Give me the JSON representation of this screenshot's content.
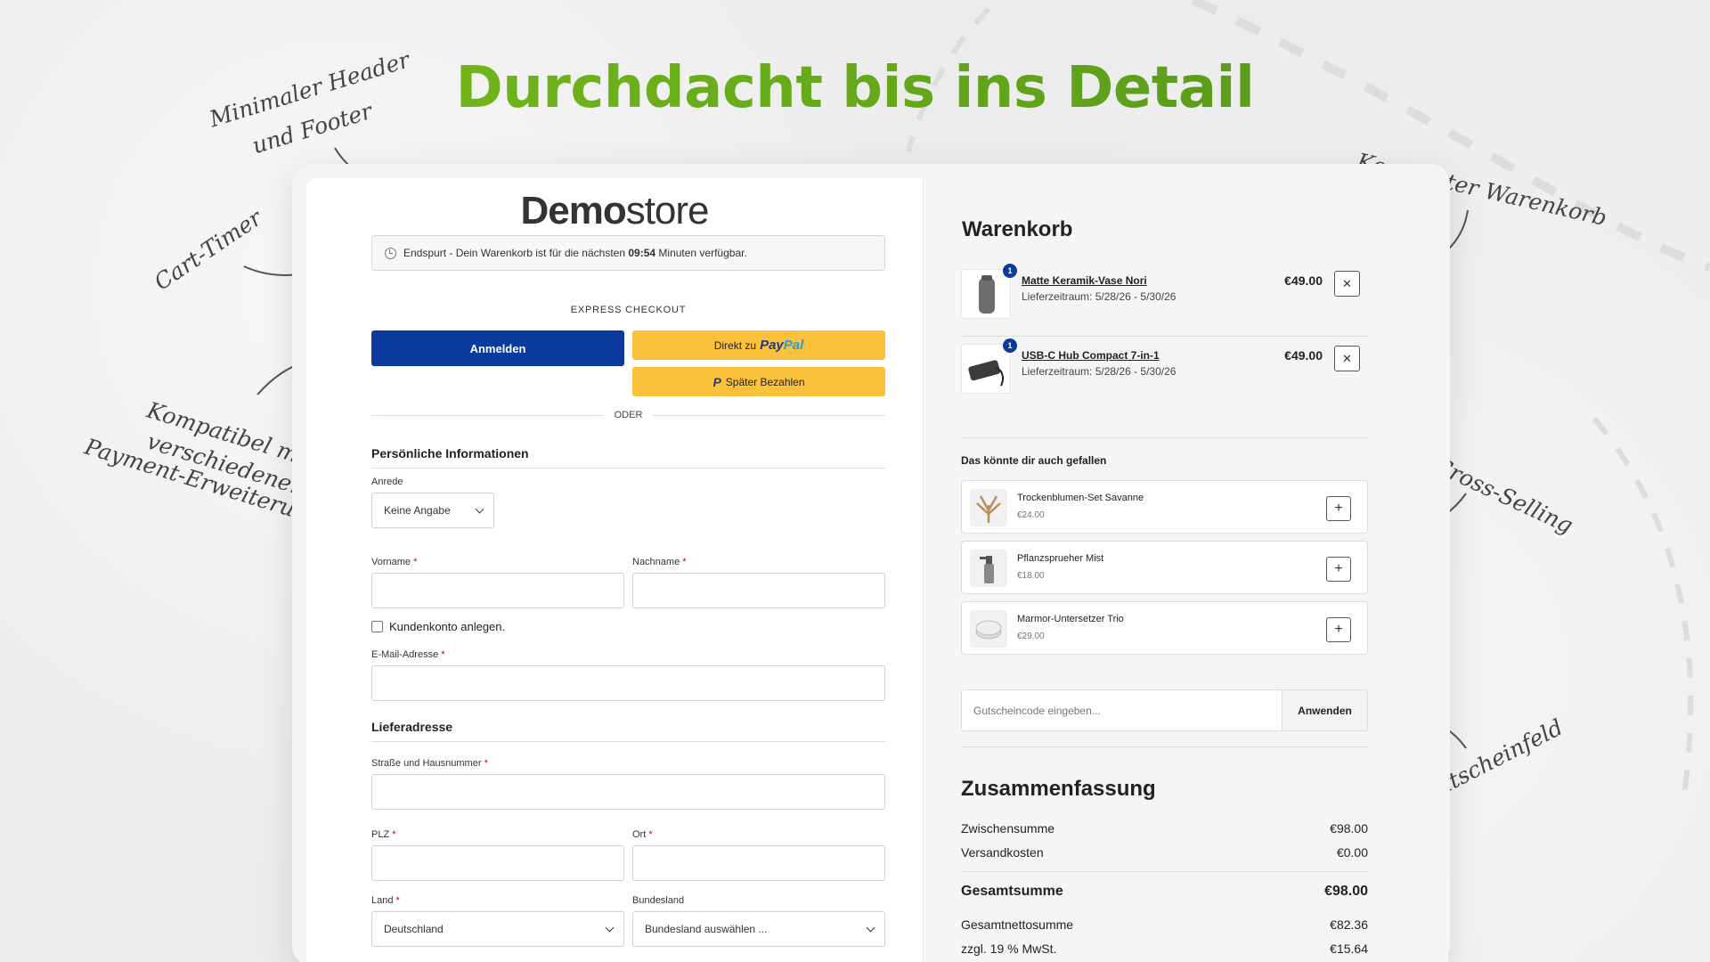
{
  "headline": "Durchdacht bis ins Detail",
  "annotations": {
    "header_footer": [
      "Minimaler Header",
      "und Footer"
    ],
    "cart_timer": "Cart-Timer",
    "payment": [
      "Kompatibel mit",
      "verschiedenen",
      "Payment-Erweiterungen"
    ],
    "compact_cart": "Kompakter Warenkorb",
    "cross_selling": "Cross-Selling",
    "voucher": "Gutscheinfeld"
  },
  "logo": {
    "bold": "Demo",
    "light": "store"
  },
  "timer": {
    "before": "Endspurt - Dein Warenkorb ist für die nächsten",
    "time": "09:54",
    "after": "Minuten verfügbar."
  },
  "express": {
    "label": "EXPRESS CHECKOUT",
    "login": "Anmelden",
    "paypal_prefix": "Direkt zu",
    "paypal_brand_a": "Pay",
    "paypal_brand_b": "Pal",
    "paylater": "Später Bezahlen",
    "or": "ODER"
  },
  "personal": {
    "title": "Persönliche Informationen",
    "salutation_label": "Anrede",
    "salutation_value": "Keine Angabe",
    "firstname_label": "Vorname",
    "lastname_label": "Nachname",
    "create_account": "Kundenkonto anlegen.",
    "email_label": "E-Mail-Adresse",
    "required_mark": "*"
  },
  "shipping": {
    "title": "Lieferadresse",
    "street_label": "Straße und Hausnummer",
    "zip_label": "PLZ",
    "city_label": "Ort",
    "country_label": "Land",
    "country_value": "Deutschland",
    "state_label": "Bundesland",
    "state_value": "Bundesland auswählen ..."
  },
  "cart": {
    "title": "Warenkorb",
    "items": [
      {
        "name": "Matte Keramik-Vase Nori",
        "delivery": "Lieferzeitraum: 5/28/26 - 5/30/26",
        "price": "€49.00",
        "qty": "1"
      },
      {
        "name": "USB-C Hub Compact 7-in-1",
        "delivery": "Lieferzeitraum: 5/28/26 - 5/30/26",
        "price": "€49.00",
        "qty": "1"
      }
    ],
    "remove_symbol": "✕"
  },
  "cross_selling": {
    "title": "Das könnte dir auch gefallen",
    "add_symbol": "+",
    "items": [
      {
        "name": "Trockenblumen-Set Savanne",
        "price": "€24.00"
      },
      {
        "name": "Pflanzsprueher Mist",
        "price": "€18.00"
      },
      {
        "name": "Marmor-Untersetzer Trio",
        "price": "€29.00"
      }
    ]
  },
  "voucher": {
    "placeholder": "Gutscheincode eingeben...",
    "button": "Anwenden"
  },
  "summary": {
    "title": "Zusammenfassung",
    "subtotal_label": "Zwischensumme",
    "subtotal_value": "€98.00",
    "shipping_label": "Versandkosten",
    "shipping_value": "€0.00",
    "total_label": "Gesamtsumme",
    "total_value": "€98.00",
    "net_label": "Gesamtnettosumme",
    "net_value": "€82.36",
    "vat_label": "zzgl. 19 % MwSt.",
    "vat_value": "€15.64"
  },
  "colors": {
    "headline_start": "#7cc21a",
    "headline_end": "#4f8f1a",
    "primary": "#0a3a9e",
    "paypal_yellow": "#fcc13a"
  }
}
